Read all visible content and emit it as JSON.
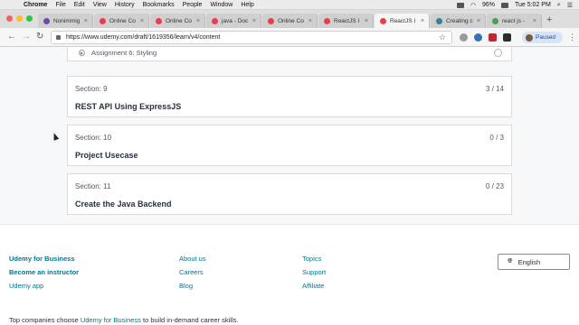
{
  "menubar": {
    "app": "Chrome",
    "items": [
      "File",
      "Edit",
      "View",
      "History",
      "Bookmarks",
      "People",
      "Window",
      "Help"
    ],
    "battery": "96%",
    "clock": "Tue 5:02 PM"
  },
  "tabs": [
    {
      "title": "Nonimmig",
      "color": "#6b4aa0"
    },
    {
      "title": "Online Co",
      "color": "#e0434f"
    },
    {
      "title": "Online Co",
      "color": "#e0434f"
    },
    {
      "title": "java - Doc",
      "color": "#e0434f"
    },
    {
      "title": "Online Co",
      "color": "#e0434f"
    },
    {
      "title": "ReactJS I",
      "color": "#e0434f"
    },
    {
      "title": "ReactJS I",
      "color": "#e0434f"
    },
    {
      "title": "Creating c",
      "color": "#3c7d8f"
    },
    {
      "title": "react js -",
      "color": "#4c9a5a"
    }
  ],
  "toolbar": {
    "url": "https://www.udemy.com/draft/1619356/learn/v4/content",
    "profile_label": "Paused"
  },
  "assignment": {
    "label": "Assignment 6: Styling"
  },
  "sections": [
    {
      "number": "Section: 9",
      "count": "3 / 14",
      "title": "REST API Using ExpressJS"
    },
    {
      "number": "Section: 10",
      "count": "0 / 3",
      "title": "Project Usecase"
    },
    {
      "number": "Section: 11",
      "count": "0 / 23",
      "title": "Create the Java Backend"
    }
  ],
  "footer": {
    "col1": [
      "Udemy for Business",
      "Become an instructor",
      "Udemy app"
    ],
    "col2": [
      "About us",
      "Careers",
      "Blog"
    ],
    "col3": [
      "Topics",
      "Support",
      "Affiliate"
    ],
    "language": "English",
    "tagline_pre": "Top companies choose ",
    "tagline_link": "Udemy for Business",
    "tagline_post": " to build in-demand career skills."
  }
}
